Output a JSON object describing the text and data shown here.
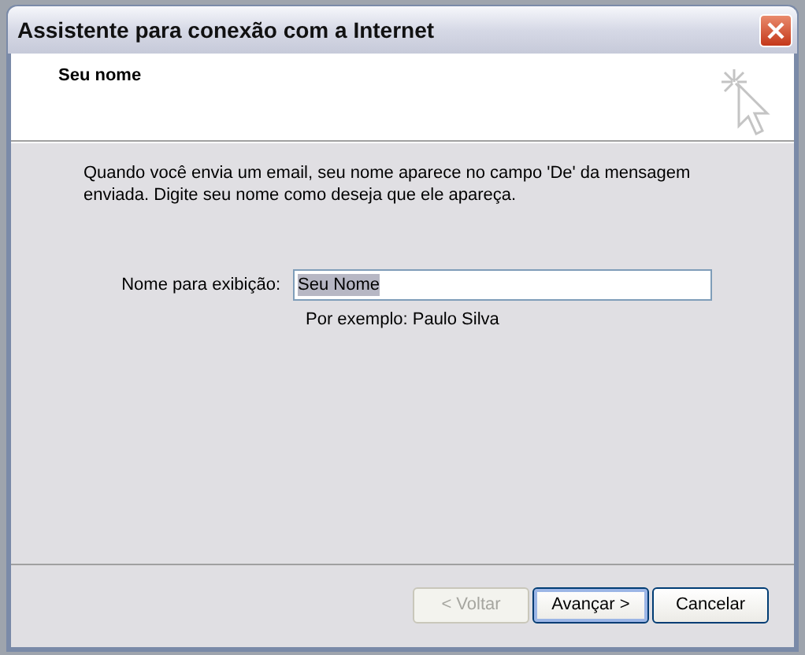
{
  "window": {
    "title": "Assistente para conexão com a Internet"
  },
  "header": {
    "title": "Seu nome"
  },
  "description": "Quando você envia um email, seu nome aparece no campo 'De' da mensagem enviada. Digite seu nome como deseja que ele apareça.",
  "display_name": {
    "label": "Nome para exibição:",
    "value": "Seu Nome",
    "text_selected": true,
    "hint": "Por exemplo: Paulo Silva"
  },
  "buttons": [
    {
      "label": "< Voltar",
      "disabled": true,
      "default": false
    },
    {
      "label": "Avançar >",
      "disabled": false,
      "default": true
    },
    {
      "label": "Cancelar",
      "disabled": false,
      "default": false
    }
  ]
}
